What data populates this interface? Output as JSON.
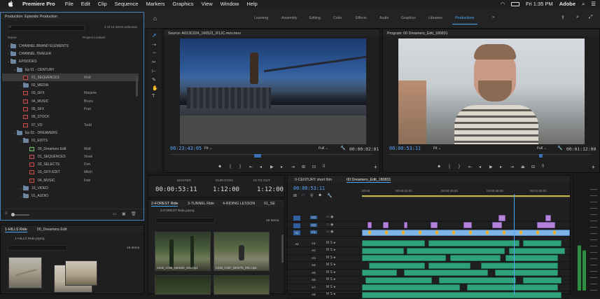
{
  "menubar": {
    "app_name": "Premiere Pro",
    "items": [
      "File",
      "Edit",
      "Clip",
      "Sequence",
      "Markers",
      "Graphics",
      "View",
      "Window",
      "Help"
    ],
    "clock": "Fri 1:35 PM",
    "adobe": "Adobe"
  },
  "workspaces": {
    "tabs": [
      "Learning",
      "Assembly",
      "Editing",
      "Color",
      "Effects",
      "Audio",
      "Graphics",
      "Libraries",
      "Productions"
    ],
    "active": "Productions"
  },
  "project": {
    "title": "Production: Episodic Production",
    "count": "1 of 14 items selected",
    "col_name": "Name",
    "col_locked": "Project Locked",
    "rows": [
      {
        "label": "CHANNEL BRAND ELEMENTS",
        "indent": 0,
        "type": "folder",
        "arrow": "›",
        "locked": ""
      },
      {
        "label": "CHANNEL TRAILER",
        "indent": 0,
        "type": "folder",
        "arrow": "›",
        "locked": ""
      },
      {
        "label": "EPISODES",
        "indent": 0,
        "type": "folder",
        "arrow": "⌄",
        "locked": ""
      },
      {
        "label": "Ep 01 - CENTURY",
        "indent": 1,
        "type": "folder",
        "arrow": "⌄",
        "locked": ""
      },
      {
        "label": "01_SEQUENCES",
        "indent": 2,
        "type": "seq",
        "arrow": "",
        "locked": "Matt",
        "selected": true
      },
      {
        "label": "02_MEDIA",
        "indent": 2,
        "type": "folder",
        "arrow": "›",
        "locked": ""
      },
      {
        "label": "03_GFX",
        "indent": 2,
        "type": "seq",
        "arrow": "",
        "locked": "Marjorie"
      },
      {
        "label": "04_MUSIC",
        "indent": 2,
        "type": "seq",
        "arrow": "",
        "locked": "Bruce"
      },
      {
        "label": "05_SFX",
        "indent": 2,
        "type": "seq",
        "arrow": "",
        "locked": "Fran"
      },
      {
        "label": "06_STOCK",
        "indent": 2,
        "type": "seq",
        "arrow": "",
        "locked": ""
      },
      {
        "label": "07_VO",
        "indent": 2,
        "type": "seq",
        "arrow": "",
        "locked": "Todd"
      },
      {
        "label": "Ep 02 - DREAMERS",
        "indent": 1,
        "type": "folder",
        "arrow": "⌄",
        "locked": ""
      },
      {
        "label": "01_EDITS",
        "indent": 2,
        "type": "folder",
        "arrow": "⌄",
        "locked": ""
      },
      {
        "label": "00_Dreamers Edit",
        "indent": 3,
        "type": "edit",
        "arrow": "",
        "locked": "Matt"
      },
      {
        "label": "01_SEQUENCES",
        "indent": 3,
        "type": "seq",
        "arrow": "",
        "locked": "Vivek"
      },
      {
        "label": "02_SELECTS",
        "indent": 3,
        "type": "seq",
        "arrow": "",
        "locked": "Don"
      },
      {
        "label": "03_GFX-EDIT",
        "indent": 3,
        "type": "seq",
        "arrow": "",
        "locked": "Mitch"
      },
      {
        "label": "04_MUSIC",
        "indent": 3,
        "type": "seq",
        "arrow": "",
        "locked": "Ivan"
      },
      {
        "label": "10_VIDEO",
        "indent": 2,
        "type": "folder",
        "arrow": "›",
        "locked": ""
      },
      {
        "label": "01_AUDIO",
        "indent": 2,
        "type": "folder",
        "arrow": "›",
        "locked": ""
      }
    ]
  },
  "bin_small": {
    "tab1": "1-HILLS Ride",
    "tab2": "00_Dreamers Edit",
    "path": "1-HILLS Ride.prproj",
    "count": "16 items"
  },
  "source": {
    "title": "Source: A013C024_160521_R1JC.mov.mov",
    "timecode": "00:23:43:05",
    "fit": "Fit",
    "quality": "Full",
    "duration": "00:00:02:01"
  },
  "program": {
    "title": "Program: 00 Dreamers_Edit_180831",
    "timecode": "00:00:53:11",
    "fit": "Fit",
    "quality": "Full",
    "duration": "00:01:12:00"
  },
  "timecode_panel": {
    "master_label": "MASTER",
    "master": "00:00:53:11",
    "duration_label": "DURATION",
    "duration": "1:12:00",
    "inout_label": "IN TO OUT",
    "inout": "1:12:00"
  },
  "bin_forest": {
    "tabs": [
      "2-FOREST Ride",
      "3-TUNNEL Ride",
      "4-RIDING LESSON",
      "01_SE"
    ],
    "path": "2-FOREST Ride.prproj",
    "count": "16 Items",
    "clip1": "C048_C006_0301BD_001.mp4",
    "clip2": "C048_C057_0301PD_001.mp4"
  },
  "timeline": {
    "tabs": [
      "0-CENTURY short film",
      "00 Dreamers_Edit_180831"
    ],
    "timecode": "00:00:53:11",
    "ruler": [
      "00:00",
      "00:00:15:00",
      "00:00:30:00",
      "00:00:45:00",
      "00:01:00:00"
    ],
    "video_tracks": [
      "V3",
      "V2",
      "V1"
    ],
    "audio_tracks": [
      "A1",
      "A2",
      "A3",
      "A4",
      "A5",
      "A6",
      "A7",
      "A8"
    ]
  },
  "colors": {
    "accent": "#4aa8ff",
    "video_clip": "#b283d8",
    "audio_clip": "#2fa27a"
  }
}
